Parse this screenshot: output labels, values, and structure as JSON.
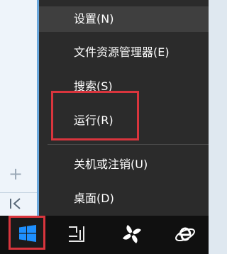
{
  "context_menu": {
    "items": [
      {
        "label": "设置(N)"
      },
      {
        "label": "文件资源管理器(E)"
      },
      {
        "label": "搜索(S)"
      },
      {
        "label": "运行(R)"
      },
      {
        "label": "关机或注销(U)"
      },
      {
        "label": "桌面(D)"
      }
    ]
  },
  "left_panel": {
    "icons": [
      "plus-icon",
      "collapse-arrow-icon"
    ]
  },
  "taskbar": {
    "icons": [
      "windows-start-icon",
      "task-view-icon",
      "fan-app-icon",
      "internet-explorer-icon"
    ]
  },
  "colors": {
    "menu_background": "#2b2b2b",
    "highlight_border": "#d9353d",
    "taskbar_background": "#101010",
    "windows_blue": "#1e90ff"
  }
}
